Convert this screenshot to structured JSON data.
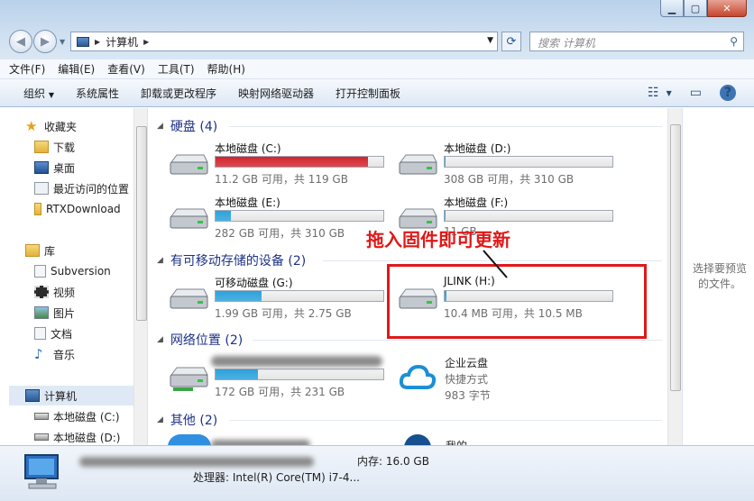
{
  "window": {
    "breadcrumb": "计算机",
    "search_placeholder": "搜索 计算机"
  },
  "menu": [
    "文件(F)",
    "编辑(E)",
    "查看(V)",
    "工具(T)",
    "帮助(H)"
  ],
  "toolbar": [
    "组织",
    "系统属性",
    "卸载或更改程序",
    "映射网络驱动器",
    "打开控制面板"
  ],
  "nav_pane": {
    "favorites_label": "收藏夹",
    "favorites": [
      "下载",
      "桌面",
      "最近访问的位置",
      "RTXDownload"
    ],
    "libraries_label": "库",
    "libraries": [
      "Subversion",
      "视频",
      "图片",
      "文档",
      "音乐"
    ],
    "computer_label": "计算机",
    "computer_items": [
      "本地磁盘 (C:)",
      "本地磁盘 (D:)"
    ]
  },
  "groups": {
    "hard_disks": "硬盘 (4)",
    "removable": "有可移动存储的设备 (2)",
    "network": "网络位置 (2)",
    "other": "其他 (2)"
  },
  "drives": [
    {
      "name": "本地磁盘 (C:)",
      "sub": "11.2 GB 可用，共 119 GB",
      "used": 0.906,
      "color": "#d5232c"
    },
    {
      "name": "本地磁盘 (D:)",
      "sub": "308 GB 可用，共 310 GB",
      "used": 0.006,
      "color": "#2aa2dc"
    },
    {
      "name": "本地磁盘 (E:)",
      "sub": "282 GB 可用，共 310 GB",
      "used": 0.09,
      "color": "#2aa2dc"
    },
    {
      "name": "本地磁盘 (F:)",
      "sub": "11 GB",
      "used": 0.006,
      "color": "#2aa2dc"
    },
    {
      "name": "可移动磁盘 (G:)",
      "sub": "1.99 GB 可用，共 2.75 GB",
      "used": 0.276,
      "color": "#2aa2dc"
    },
    {
      "name": "JLINK (H:)",
      "sub": "10.4 MB 可用，共 10.5 MB",
      "used": 0.01,
      "color": "#2aa2dc"
    },
    {
      "name": "",
      "sub": "172 GB 可用，共 231 GB",
      "used": 0.255,
      "color": "#2aa2dc"
    }
  ],
  "cloud_item": {
    "name": "企业云盘",
    "type": "快捷方式",
    "size": "983 字节"
  },
  "other_items": {
    "item2_prefix": "我的"
  },
  "preview_text": "选择要预览的文件。",
  "status": {
    "memory": "内存: 16.0 GB",
    "cpu": "处理器: Intel(R) Core(TM) i7-4..."
  },
  "annotation": "拖入固件即可更新",
  "colors": {
    "accent": "#1e3287",
    "annotation": "#e01818",
    "bar_blue": "#2aa2dc",
    "bar_red": "#d5232c"
  }
}
